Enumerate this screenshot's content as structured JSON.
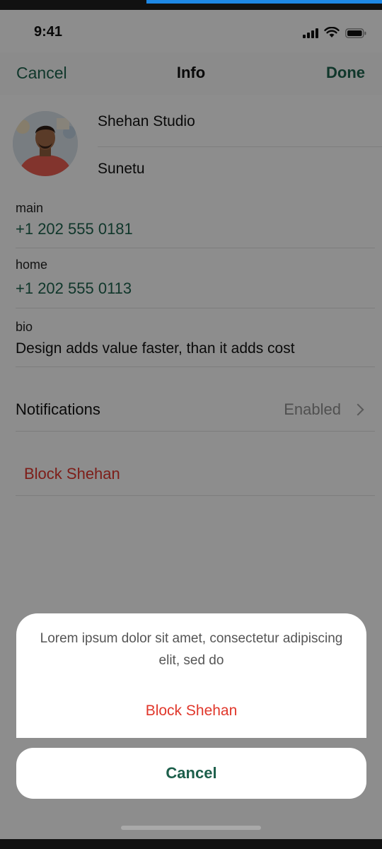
{
  "status_bar": {
    "time": "9:41"
  },
  "nav": {
    "cancel_label": "Cancel",
    "title": "Info",
    "done_label": "Done"
  },
  "profile": {
    "first_name": "Shehan Studio",
    "last_name": "Sunetu"
  },
  "fields": [
    {
      "label": "main",
      "value": "+1 202 555 0181"
    },
    {
      "label": "home",
      "value": "+1 202 555 0113"
    },
    {
      "label": "bio",
      "value": "Design adds value faster, than it adds cost"
    }
  ],
  "notifications": {
    "label": "Notifications",
    "value": "Enabled"
  },
  "block_link": "Block Shehan",
  "action_sheet": {
    "message": "Lorem ipsum dolor sit amet, consectetur adipiscing elit, sed do",
    "action_label": "Block Shehan",
    "cancel_label": "Cancel"
  },
  "colors": {
    "accent": "#1d5f4b",
    "danger": "#d8342b"
  },
  "icons": [
    "signal-icon",
    "wifi-icon",
    "battery-icon",
    "chevron-right-icon"
  ]
}
